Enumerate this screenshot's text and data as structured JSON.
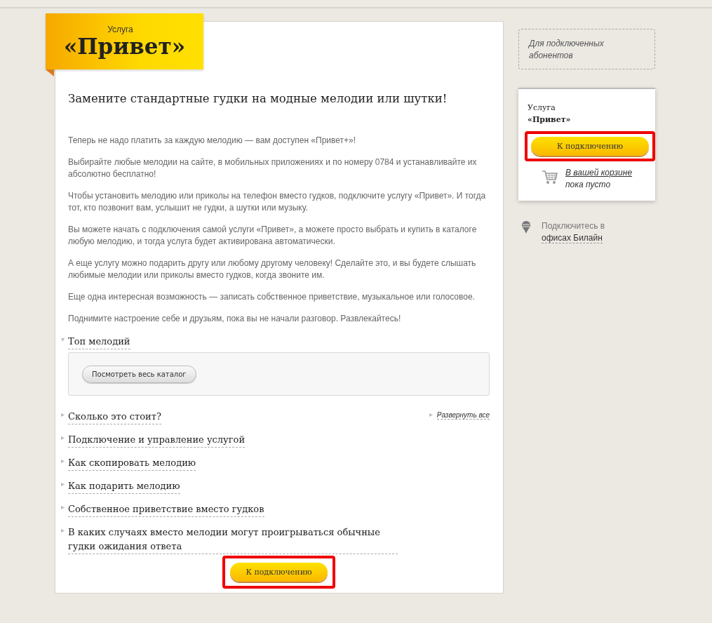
{
  "banner": {
    "kicker": "Услуга",
    "title": "«Привет»"
  },
  "headline": "Замените стандартные гудки на модные мелодии или шутки!",
  "paragraphs": [
    "Теперь не надо платить за каждую мелодию — вам доступен «Привет+»!",
    "Выбирайте любые мелодии на сайте, в мобильных приложениях и по номеру 0784 и устанавливайте их абсолютно бесплатно!",
    "Чтобы установить мелодию или приколы на телефон вместо гудков, подключите услугу «Привет». И тогда тот, кто позвонит вам, услышит не гудки, а шутки или музыку.",
    "Вы можете начать с подключения самой услуги «Привет», а можете просто выбрать и купить в каталоге любую мелодию, и тогда услуга будет активирована автоматически.",
    "А еще услугу можно подарить другу или любому другому человеку! Сделайте это, и вы будете слышать любимые мелодии или приколы вместо гудков, когда звоните им.",
    "Еще одна интересная возможность — записать собственное приветствие, музыкальное или голосовое.",
    "Поднимите настроение себе и друзьям, пока вы не начали разговор. Развлекайтесь!"
  ],
  "sections": [
    {
      "title": "Топ мелодий",
      "expanded": true,
      "button": "Посмотреть весь каталог"
    },
    {
      "title": "Сколько это стоит?",
      "expanded": false
    },
    {
      "title": "Подключение и управление услугой",
      "expanded": false
    },
    {
      "title": "Как скопировать мелодию",
      "expanded": false
    },
    {
      "title": "Как подарить мелодию",
      "expanded": false
    },
    {
      "title": "Собственное приветствие вместо гудков",
      "expanded": false
    },
    {
      "title": "В каких случаях вместо мелодии могут проигрываться обычные гудки ожидания ответа",
      "expanded": false
    }
  ],
  "expand_all": "Развернуть все",
  "main_button": {
    "label": "К подключению",
    "highlighted": true
  },
  "sidebar": {
    "note": "Для подключенных абонентов",
    "card": {
      "kicker": "Услуга",
      "title": "«Привет»",
      "button": {
        "label": "К подключению",
        "highlighted": true
      },
      "cart_link": "В вашей корзине",
      "cart_status": "пока пусто"
    },
    "offices_text": "Подключитесь в",
    "offices_link": "офисах Билайн"
  }
}
